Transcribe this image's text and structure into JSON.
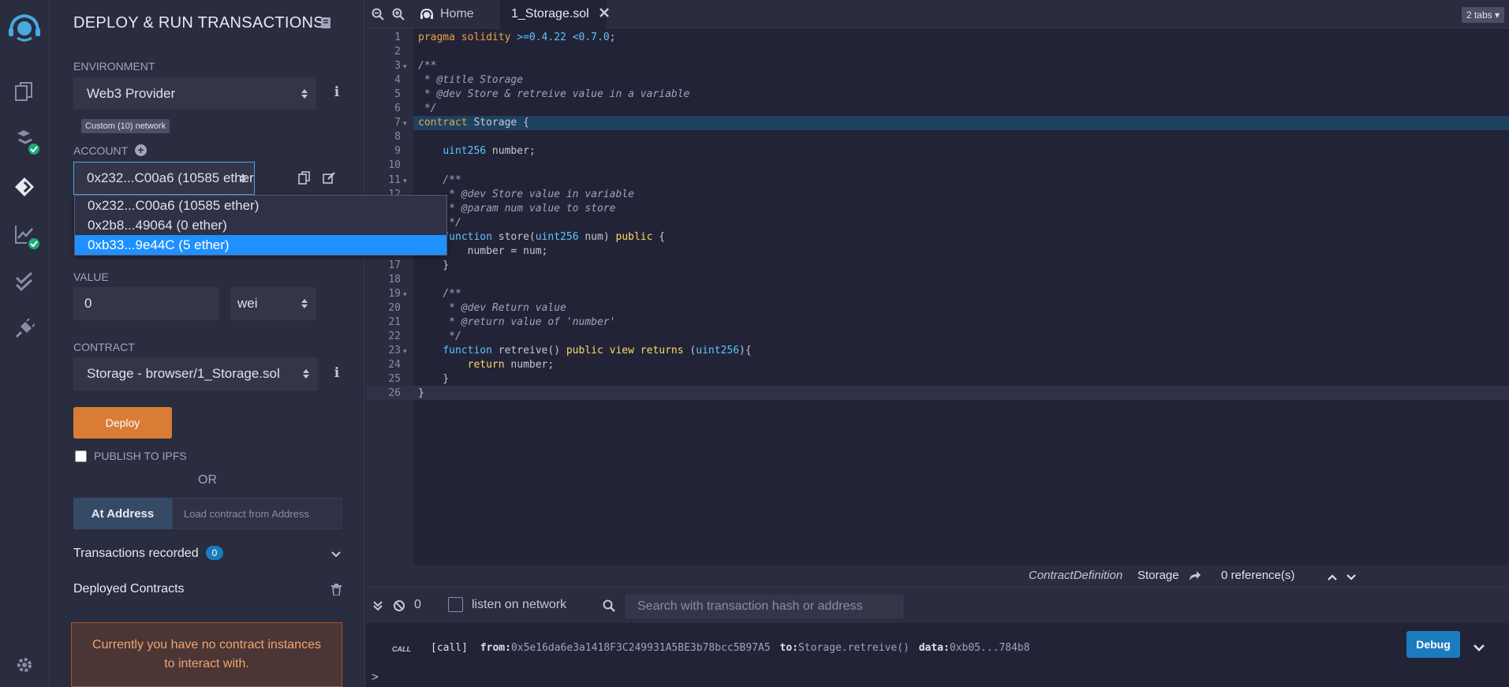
{
  "panel": {
    "title": "DEPLOY & RUN TRANSACTIONS",
    "environment_label": "ENVIRONMENT",
    "environment_value": "Web3 Provider",
    "network_badge": "Custom (10) network",
    "account_label": "ACCOUNT",
    "account_value": "0x232...C00a6 (10585 ether)",
    "account_options": [
      "0x232...C00a6 (10585 ether)",
      "0x2b8...49064 (0 ether)",
      "0xb33...9e44C (5 ether)"
    ],
    "value_label": "VALUE",
    "value_amount": "0",
    "value_unit": "wei",
    "contract_label": "CONTRACT",
    "contract_value": "Storage - browser/1_Storage.sol",
    "deploy_label": "Deploy",
    "publish_label": "PUBLISH TO IPFS",
    "or_label": "OR",
    "at_address_label": "At Address",
    "at_address_placeholder": "Load contract from Address",
    "transactions_label": "Transactions recorded",
    "transactions_count": "0",
    "deployed_label": "Deployed Contracts",
    "empty_message": "Currently you have no contract instances to interact with."
  },
  "tabs": {
    "home": "Home",
    "file": "1_Storage.sol",
    "count": "2 tabs"
  },
  "code_lines": [
    "pragma solidity >=0.4.22 <0.7.0;",
    "",
    "/**",
    " * @title Storage",
    " * @dev Store & retreive value in a variable",
    " */",
    "contract Storage {",
    "",
    "    uint256 number;",
    "",
    "    /**",
    "     * @dev Store value in variable",
    "     * @param num value to store",
    "     */",
    "    function store(uint256 num) public {",
    "        number = num;",
    "    }",
    "",
    "    /**",
    "     * @dev Return value",
    "     * @return value of 'number'",
    "     */",
    "    function retreive() public view returns (uint256){",
    "        return number;",
    "    }",
    "}"
  ],
  "refbar": {
    "kind": "ContractDefinition",
    "name": "Storage",
    "references": "0 reference(s)"
  },
  "terminal": {
    "pending_count": "0",
    "listen_label": "listen on network",
    "search_placeholder": "Search with transaction hash or address",
    "log_kind": "CALL",
    "log_call": "[call]",
    "from_label": "from:",
    "from_value": "0x5e16da6e3a1418F3C249931A5BE3b78bcc5B97A5",
    "to_label": "to:",
    "to_value": "Storage.retreive()",
    "data_label": "data:",
    "data_value": "0xb05...784b8",
    "debug_label": "Debug",
    "prompt": ">"
  }
}
